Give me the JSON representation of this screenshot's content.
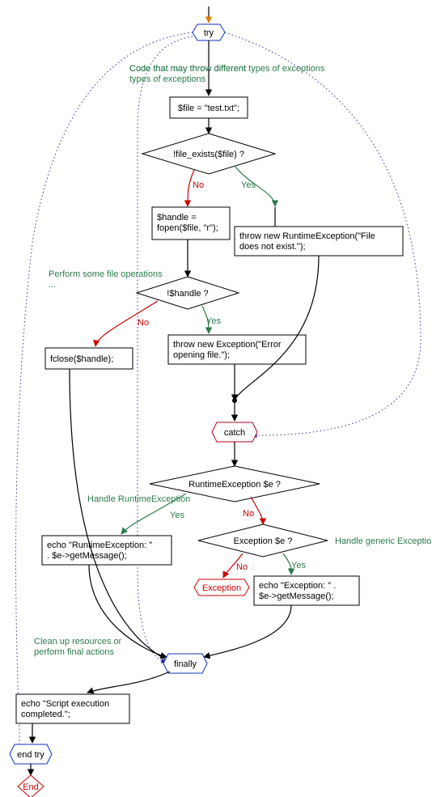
{
  "chart_data": {
    "type": "diagram",
    "title": "",
    "nodes": [
      {
        "id": "start",
        "kind": "start",
        "label": ""
      },
      {
        "id": "try",
        "kind": "try",
        "label": "try"
      },
      {
        "id": "c_try",
        "kind": "comment",
        "text": "Code that may throw different types of exceptions"
      },
      {
        "id": "assign",
        "kind": "process",
        "text": "$file = \"test.txt\";"
      },
      {
        "id": "d_exists",
        "kind": "decision",
        "text": "!file_exists($file) ?"
      },
      {
        "id": "fopen",
        "kind": "process",
        "text": "$handle = fopen($file, \"r\");"
      },
      {
        "id": "throw_runtime",
        "kind": "process",
        "text": "throw new RuntimeException(\"File does not exist.\");"
      },
      {
        "id": "c_perform",
        "kind": "comment",
        "text": "Perform some file operations ..."
      },
      {
        "id": "d_handle",
        "kind": "decision",
        "text": "!$handle ?"
      },
      {
        "id": "fclose",
        "kind": "process",
        "text": "fclose($handle);"
      },
      {
        "id": "throw_exc",
        "kind": "process",
        "text": "throw new Exception(\"Error opening file.\");"
      },
      {
        "id": "catch",
        "kind": "catch",
        "label": "catch"
      },
      {
        "id": "d_runtime",
        "kind": "decision",
        "text": "RuntimeException $e ?"
      },
      {
        "id": "c_runtime",
        "kind": "comment",
        "text": "Handle RuntimeException"
      },
      {
        "id": "echo_runtime",
        "kind": "process",
        "text": "echo \"RuntimeException: \" . $e->getMessage();"
      },
      {
        "id": "d_exc",
        "kind": "decision",
        "text": "Exception $e ?"
      },
      {
        "id": "c_exc",
        "kind": "comment",
        "text": "Handle generic Exception"
      },
      {
        "id": "echo_exc",
        "kind": "process",
        "text": "echo \"Exception: \" . $e->getMessage();"
      },
      {
        "id": "exc_node",
        "kind": "exception",
        "label": "Exception"
      },
      {
        "id": "finally",
        "kind": "finally",
        "label": "finally"
      },
      {
        "id": "c_finally",
        "kind": "comment",
        "text": "Clean up resources or perform final actions"
      },
      {
        "id": "echo_done",
        "kind": "process",
        "text": "echo \"Script execution completed.\";"
      },
      {
        "id": "endtry",
        "kind": "endtry",
        "label": "end try"
      },
      {
        "id": "end",
        "kind": "end",
        "label": "End"
      }
    ],
    "edges": [
      {
        "from": "start",
        "to": "try"
      },
      {
        "from": "try",
        "to": "assign",
        "via_comment": "c_try"
      },
      {
        "from": "assign",
        "to": "d_exists"
      },
      {
        "from": "d_exists",
        "to": "throw_runtime",
        "label": "Yes"
      },
      {
        "from": "d_exists",
        "to": "fopen",
        "label": "No"
      },
      {
        "from": "fopen",
        "to": "d_handle",
        "via_comment": "c_perform"
      },
      {
        "from": "d_handle",
        "to": "throw_exc",
        "label": "Yes"
      },
      {
        "from": "d_handle",
        "to": "fclose",
        "label": "No"
      },
      {
        "from": "throw_runtime",
        "to": "catch",
        "kind": "exception"
      },
      {
        "from": "throw_exc",
        "to": "catch",
        "kind": "exception"
      },
      {
        "from": "catch",
        "to": "d_runtime"
      },
      {
        "from": "d_runtime",
        "to": "echo_runtime",
        "label": "Yes",
        "via_comment": "c_runtime"
      },
      {
        "from": "d_runtime",
        "to": "d_exc",
        "label": "No"
      },
      {
        "from": "d_exc",
        "to": "echo_exc",
        "label": "Yes",
        "via_comment": "c_exc"
      },
      {
        "from": "d_exc",
        "to": "exc_node",
        "label": "No"
      },
      {
        "from": "echo_runtime",
        "to": "finally"
      },
      {
        "from": "echo_exc",
        "to": "finally"
      },
      {
        "from": "fclose",
        "to": "finally"
      },
      {
        "from": "finally",
        "to": "echo_done",
        "via_comment": "c_finally"
      },
      {
        "from": "echo_done",
        "to": "endtry"
      },
      {
        "from": "endtry",
        "to": "end"
      },
      {
        "from": "try",
        "to": "catch",
        "kind": "scope_dashed"
      },
      {
        "from": "try",
        "to": "finally",
        "kind": "scope_dashed"
      },
      {
        "from": "try",
        "to": "endtry",
        "kind": "scope_dashed"
      }
    ],
    "labels": {
      "yes": "Yes",
      "no": "No"
    }
  }
}
